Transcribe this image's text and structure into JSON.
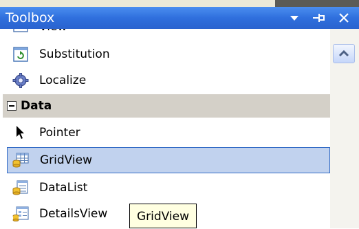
{
  "window": {
    "title": "Toolbox"
  },
  "titlebar_buttons": [
    {
      "name": "dropdown-arrow-icon",
      "glyph": "▼"
    },
    {
      "name": "pin-icon",
      "glyph": "⊣"
    },
    {
      "name": "close-icon",
      "glyph": "✕"
    }
  ],
  "items": {
    "partial_label": "View",
    "substitution": "Substitution",
    "localize": "Localize",
    "category_data": "Data",
    "pointer": "Pointer",
    "gridview": "GridView",
    "datalist": "DataList",
    "detailsview": "DetailsView"
  },
  "tooltip": {
    "text": "GridView"
  },
  "colors": {
    "titlebar": "#2f6fdd",
    "selection_bg": "#c1d2ee",
    "selection_border": "#316ac5",
    "category_bg": "#d4d0c8",
    "tooltip_bg": "#ffffe1"
  }
}
